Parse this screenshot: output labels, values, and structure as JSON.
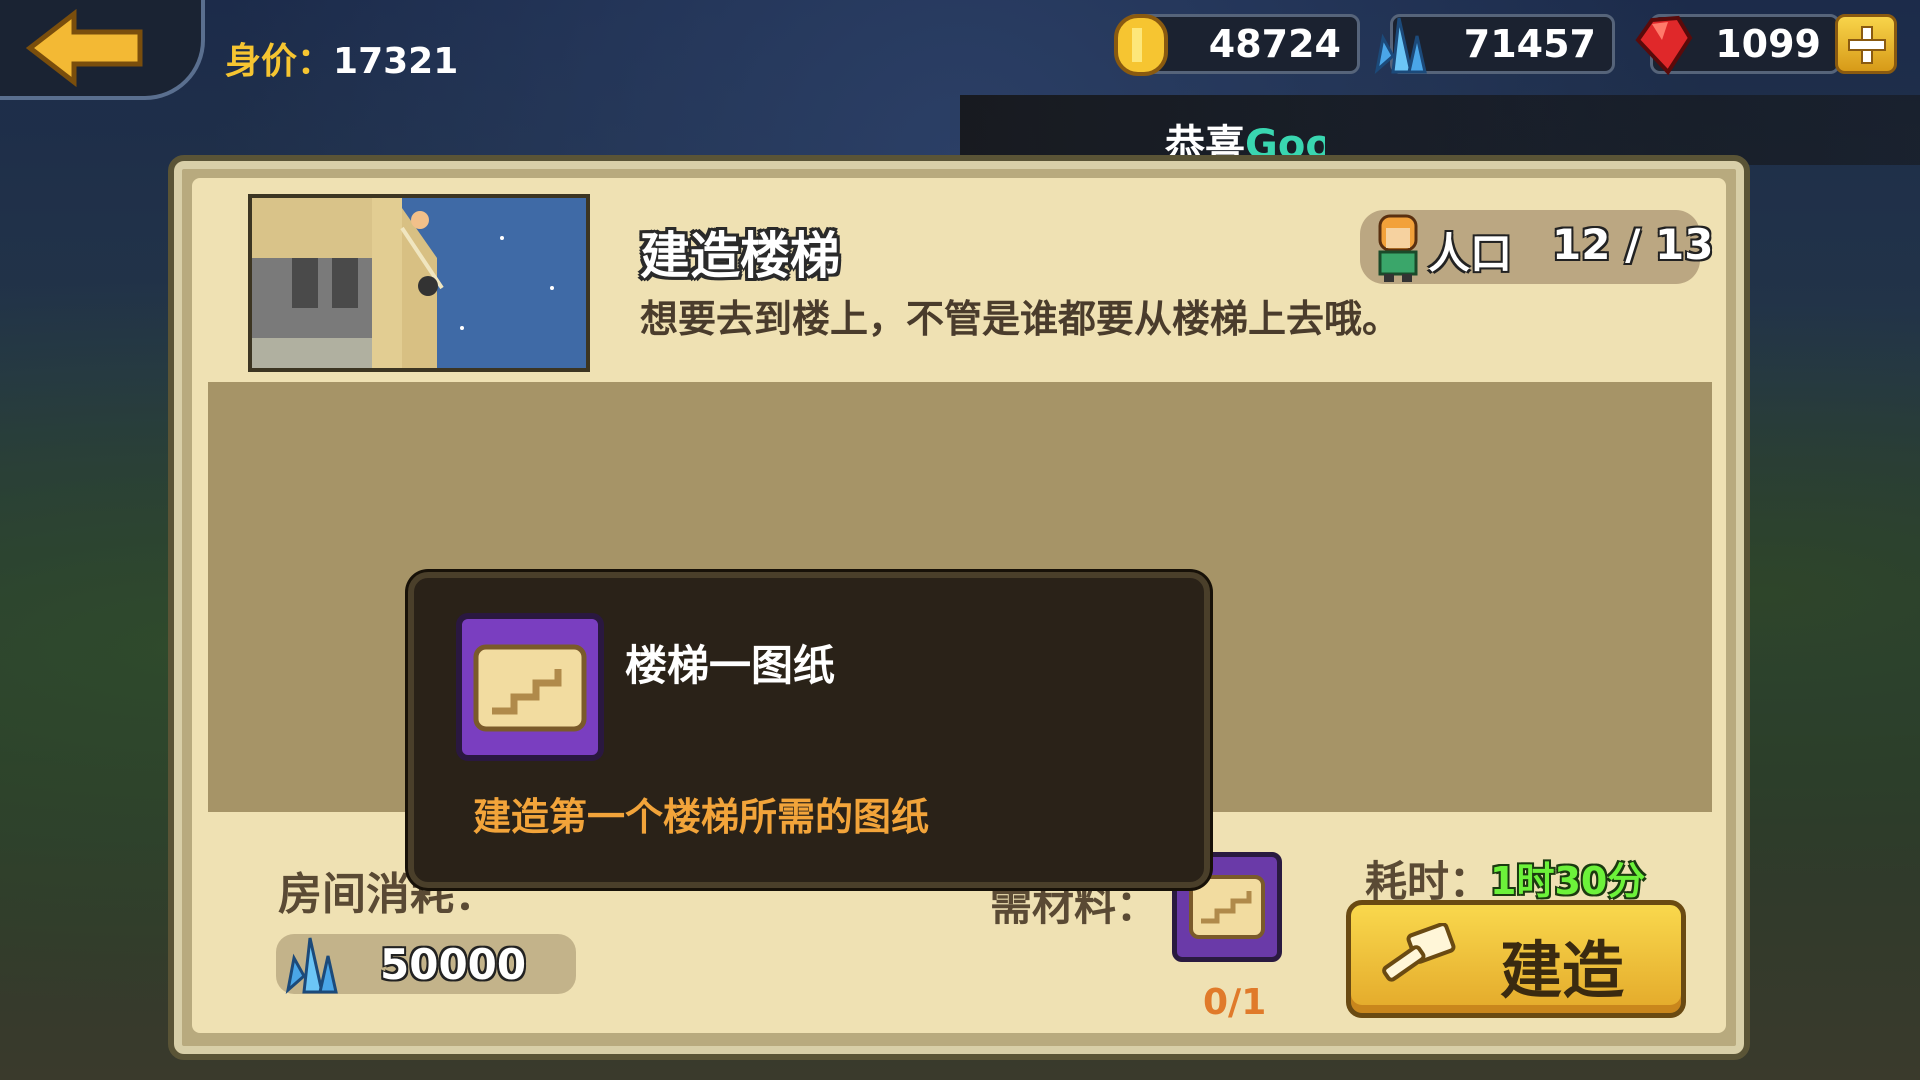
{
  "header": {
    "worth_label": "身价：",
    "worth_value": "17321",
    "gold": "48724",
    "crystal": "71457",
    "ruby": "1099"
  },
  "ticker": {
    "prefix": "恭喜",
    "name": "Goo"
  },
  "building": {
    "title": "建造楼梯",
    "description": "想要去到楼上，不管是谁都要从楼梯上去哦。",
    "population_label": "人口",
    "population_value": "12 / 13"
  },
  "cost": {
    "label": "房间消耗：",
    "crystal_cost": "50000"
  },
  "material": {
    "label": "需材料：",
    "count": "0/1"
  },
  "time": {
    "label": "耗时：",
    "value": "1时30分"
  },
  "build_button": {
    "label": "建造"
  },
  "tooltip": {
    "item_name": "楼梯一图纸",
    "item_description": "建造第一个楼梯所需的图纸"
  },
  "colors": {
    "gold": "#f6c531",
    "accent_green": "#6cf23a",
    "accent_orange": "#f2a43a",
    "rare_purple": "#7a3ec0"
  },
  "icons": [
    "back-arrow-icon",
    "gold-coin-icon",
    "crystal-icon",
    "ruby-icon",
    "plus-icon",
    "villager-icon",
    "blueprint-scroll-icon",
    "hammer-icon"
  ]
}
